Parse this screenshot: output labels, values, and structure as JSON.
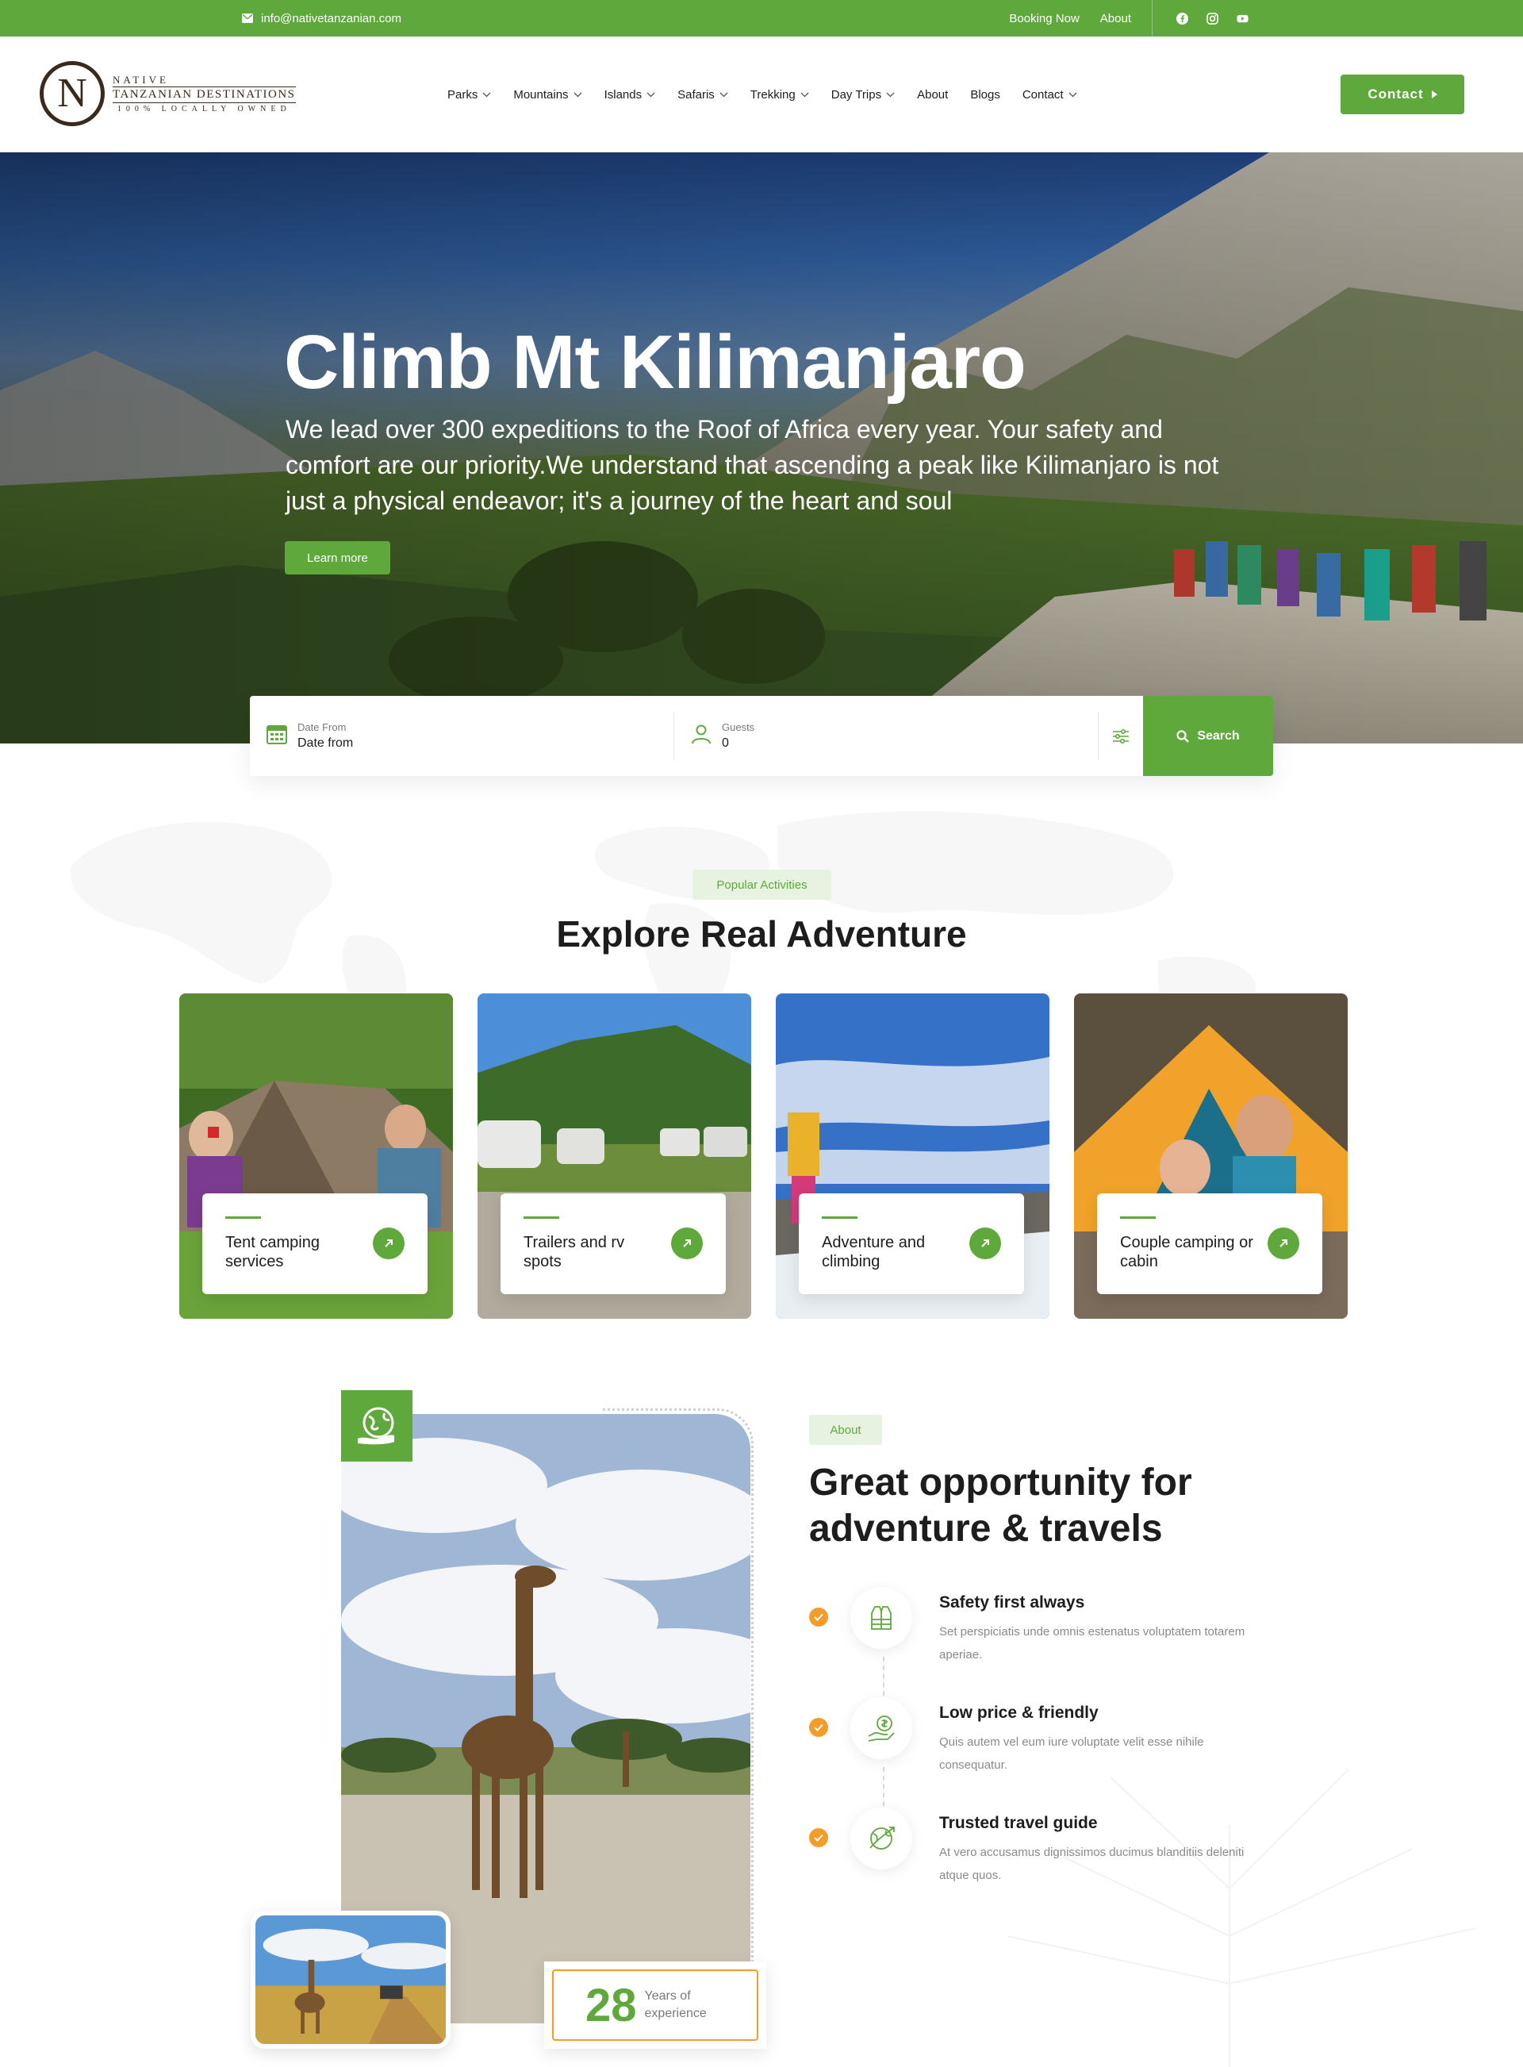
{
  "topbar": {
    "email": "info@nativetanzanian.com",
    "links": [
      "Booking Now",
      "About"
    ],
    "social_icons": [
      "facebook-icon",
      "instagram-icon",
      "youtube-icon"
    ]
  },
  "logo": {
    "letter": "N",
    "line1": "NATIVE",
    "line2": "TANZANIAN DESTINATIONS",
    "line3": "100% LOCALLY OWNED"
  },
  "nav": {
    "items": [
      {
        "label": "Parks",
        "dropdown": true
      },
      {
        "label": "Mountains",
        "dropdown": true
      },
      {
        "label": "Islands",
        "dropdown": true
      },
      {
        "label": "Safaris",
        "dropdown": true
      },
      {
        "label": "Trekking",
        "dropdown": true
      },
      {
        "label": "Day Trips",
        "dropdown": true
      },
      {
        "label": "About",
        "dropdown": false
      },
      {
        "label": "Blogs",
        "dropdown": false
      },
      {
        "label": "Contact",
        "dropdown": true
      }
    ],
    "cta": "Contact"
  },
  "hero": {
    "title": "Climb Mt Kilimanjaro",
    "text": "We lead over 300 expeditions to the Roof of Africa every year. Your safety and comfort are our priority.We understand that ascending a peak like Kilimanjaro is not just a physical endeavor; it's a journey of the heart and soul",
    "button": "Learn more"
  },
  "search": {
    "date_label": "Date From",
    "date_value": "Date from",
    "guests_label": "Guests",
    "guests_value": "0",
    "button": "Search"
  },
  "activities": {
    "tag": "Popular Activities",
    "title": "Explore Real Adventure",
    "cards": [
      {
        "title": "Tent camping services"
      },
      {
        "title": "Trailers and rv spots"
      },
      {
        "title": "Adventure and climbing"
      },
      {
        "title": "Couple camping or cabin"
      }
    ]
  },
  "about": {
    "tag": "About",
    "title": "Great opportunity for adventure & travels",
    "experience_number": "28",
    "experience_label": "Years of experience",
    "features": [
      {
        "title": "Safety first always",
        "text": "Set perspiciatis unde omnis estenatus voluptatem totarem aperiae.",
        "icon": "life-vest-icon"
      },
      {
        "title": "Low price & friendly",
        "text": "Quis autem vel eum iure voluptate velit esse nihile consequatur.",
        "icon": "money-hand-icon"
      },
      {
        "title": "Trusted travel guide",
        "text": "At vero accusamus dignissimos ducimus blanditiis deleniti atque quos.",
        "icon": "compass-globe-icon"
      }
    ]
  },
  "colors": {
    "brand_green": "#5fa83c",
    "accent_orange": "#f39c2a",
    "logo_brown": "#3a2a1c"
  }
}
